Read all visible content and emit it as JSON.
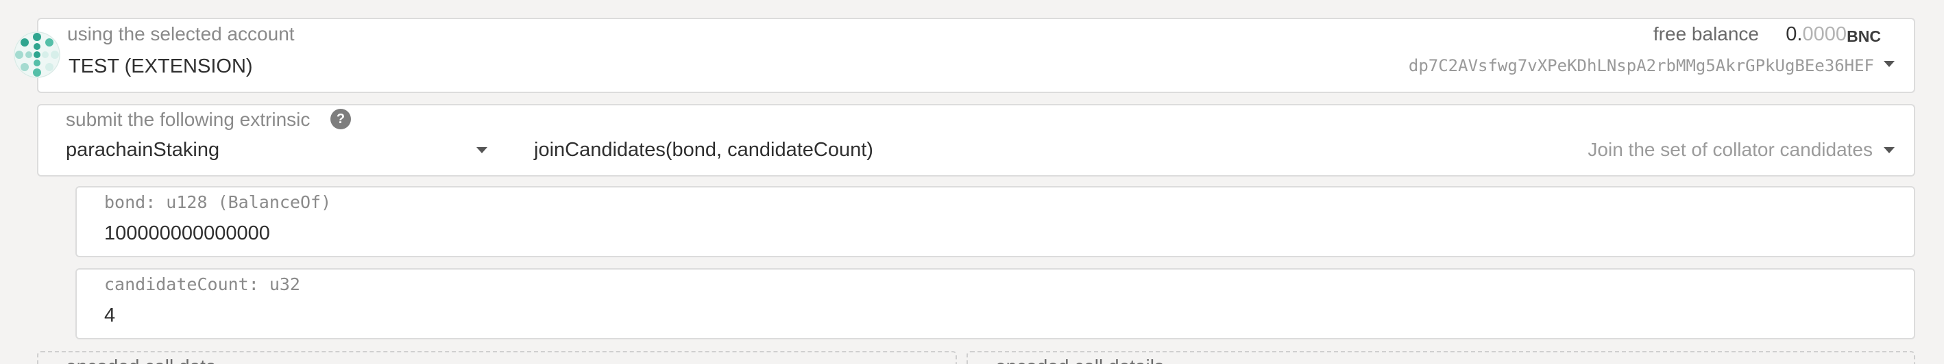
{
  "account": {
    "label": "using the selected account",
    "name": "TEST (EXTENSION)",
    "free_balance_label": "free balance",
    "balance_int": "0.",
    "balance_dec": "0000",
    "balance_unit": "BNC",
    "address": "dp7C2AVsfwg7vXPeKDhLNspA2rbMMg5AkrGPkUgBEe36HEF",
    "avatar_icon": "polkadot-identicon",
    "avatar_colors": [
      "#2fa58f",
      "#55bfa8",
      "#a4dbd0",
      "#d7efea"
    ]
  },
  "extrinsic": {
    "label": "submit the following extrinsic",
    "help_icon_glyph": "?",
    "pallet": "parachainStaking",
    "call": "joinCandidates(bond, candidateCount)",
    "call_description": "Join the set of collator candidates"
  },
  "params": [
    {
      "label": "bond: u128 (BalanceOf)",
      "value": "100000000000000"
    },
    {
      "label": "candidateCount: u32",
      "value": "4"
    }
  ],
  "encoded": {
    "call_data_label": "encoded call data",
    "call_details_label": "encoded call details"
  }
}
